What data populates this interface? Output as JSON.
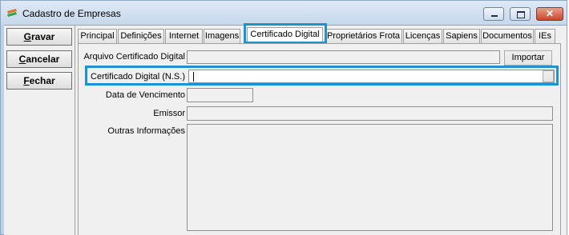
{
  "window": {
    "title": "Cadastro de Empresas",
    "controls": [
      "minimize",
      "maximize",
      "close"
    ]
  },
  "actions": [
    {
      "label": "Gravar",
      "mnemonic": "G"
    },
    {
      "label": "Cancelar",
      "mnemonic": "C"
    },
    {
      "label": "Fechar",
      "mnemonic": "F"
    }
  ],
  "tabs": [
    {
      "label": "Principal"
    },
    {
      "label": "Definições"
    },
    {
      "label": "Internet"
    },
    {
      "label": "Imagens"
    },
    {
      "label": "Certificado Digital",
      "active": true
    },
    {
      "label": "Proprietários Frota"
    },
    {
      "label": "Licenças"
    },
    {
      "label": "Sapiens"
    },
    {
      "label": "Documentos"
    },
    {
      "label": "IEs"
    }
  ],
  "form": {
    "arquivo_label": "Arquivo Certificado Digital",
    "arquivo_value": "",
    "importar_label": "Importar",
    "ns_label": "Certificado Digital (N.S.)",
    "ns_value": "",
    "vencimento_label": "Data de Vencimento",
    "vencimento_value": "",
    "emissor_label": "Emissor",
    "emissor_value": "",
    "outras_label": "Outras Informações",
    "outras_value": ""
  },
  "colors": {
    "highlight": "#1b93d1",
    "close_button": "#c8452b",
    "titlebar": "#c6d8ec"
  },
  "icons": [
    "app-icon",
    "minimize-icon",
    "maximize-icon",
    "close-icon"
  ]
}
